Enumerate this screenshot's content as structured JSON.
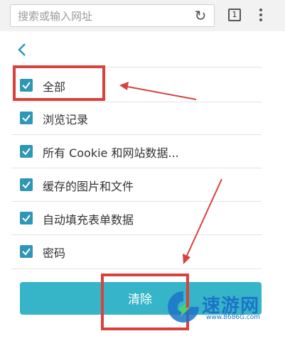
{
  "browser": {
    "search_placeholder": "搜索或输入网址",
    "tab_count": "1",
    "refresh_icon": "refresh-icon",
    "menu_icon": "more-vert-icon"
  },
  "nav": {
    "back_icon": "chevron-left-icon"
  },
  "options": [
    {
      "label": "全部",
      "checked": true
    },
    {
      "label": "浏览记录",
      "checked": true
    },
    {
      "label": "所有 Cookie 和网站数据...",
      "checked": true
    },
    {
      "label": "缓存的图片和文件",
      "checked": true
    },
    {
      "label": "自动填充表单数据",
      "checked": true
    },
    {
      "label": "密码",
      "checked": true
    }
  ],
  "actions": {
    "clear_label": "清除"
  },
  "colors": {
    "checkbox": "#2e97b6",
    "button": "#35b5c7",
    "annotation": "#d8413c",
    "watermark": "#1c73c9"
  },
  "watermark": {
    "title": "速游网",
    "url": "www.8686G.com"
  }
}
